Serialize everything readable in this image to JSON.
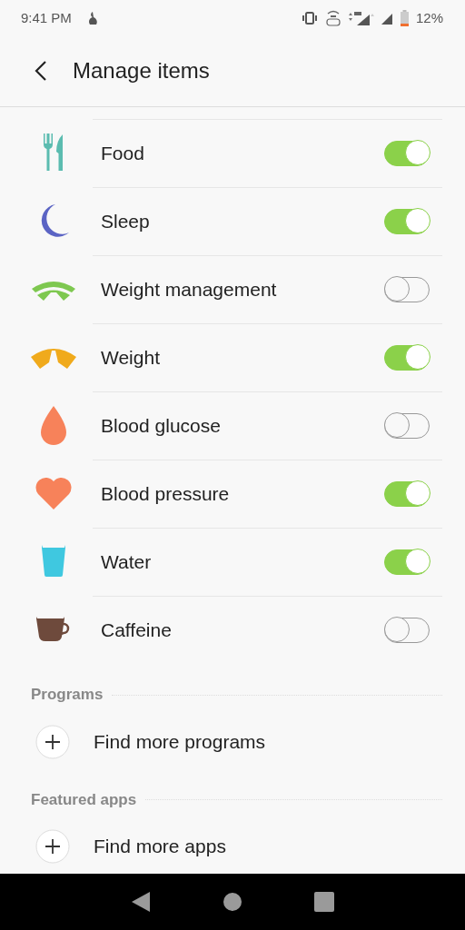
{
  "status_bar": {
    "time": "9:41 PM",
    "battery": "12%"
  },
  "header": {
    "title": "Manage items"
  },
  "items": [
    {
      "label": "Food",
      "on": true
    },
    {
      "label": "Sleep",
      "on": true
    },
    {
      "label": "Weight management",
      "on": false
    },
    {
      "label": "Weight",
      "on": true
    },
    {
      "label": "Blood glucose",
      "on": false
    },
    {
      "label": "Blood pressure",
      "on": true
    },
    {
      "label": "Water",
      "on": true
    },
    {
      "label": "Caffeine",
      "on": false
    }
  ],
  "sections": [
    {
      "title": "Programs",
      "action": "Find more programs"
    },
    {
      "title": "Featured apps",
      "action": "Find more apps"
    }
  ]
}
